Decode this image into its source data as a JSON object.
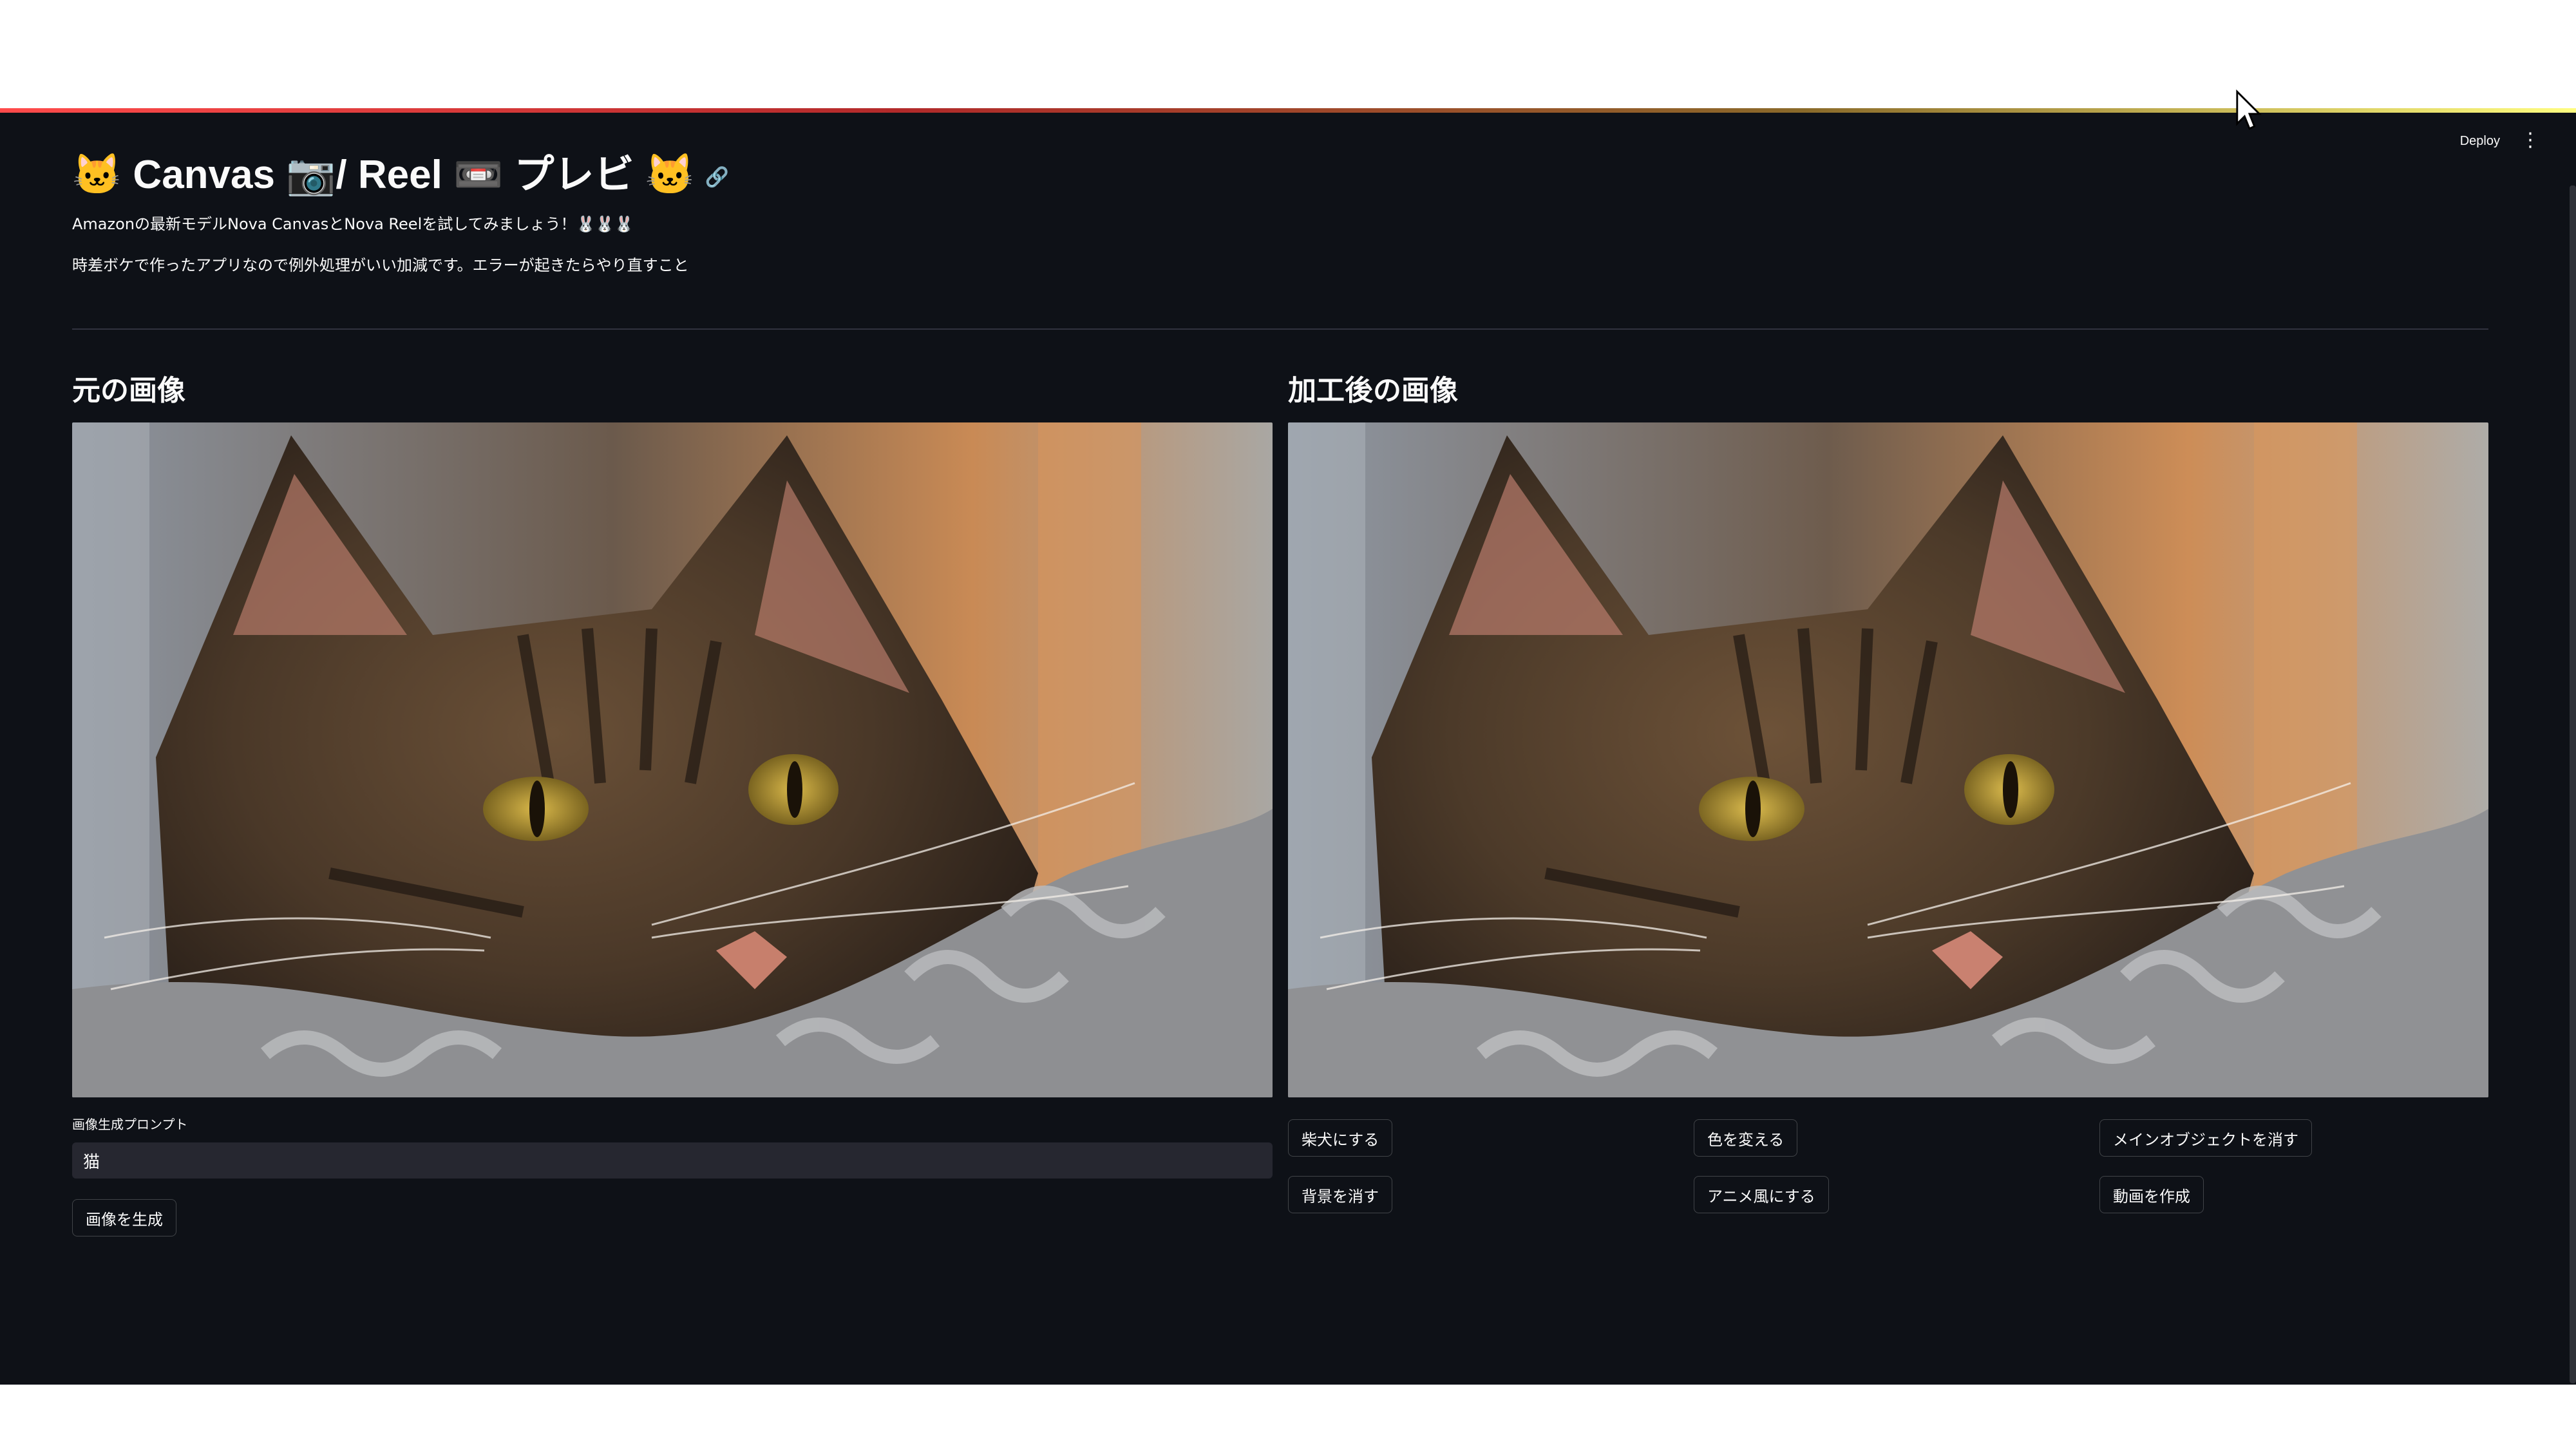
{
  "header": {
    "title": "🐱 Canvas 📷/ Reel 📼 プレビ 🐱",
    "link_icon": "link-icon",
    "deploy_label": "Deploy",
    "menu_icon": "vertical-dots-icon"
  },
  "captions": {
    "line1": "Amazonの最新モデルNova CanvasとNova Reelを試してみましょう！🐰🐰🐰",
    "line2": "時差ボケで作ったアプリなので例外処理がいい加減です。エラーが起きたらやり直すこと"
  },
  "left_column": {
    "heading": "元の画像",
    "image_alt": "tabby cat resting on knitted blanket",
    "prompt_label": "画像生成プロンプト",
    "prompt_value": "猫",
    "generate_button": "画像を生成"
  },
  "right_column": {
    "heading": "加工後の画像",
    "image_alt": "tabby cat resting on knitted blanket (processed)",
    "buttons": [
      "柴犬にする",
      "色を変える",
      "メインオブジェクトを消す",
      "背景を消す",
      "アニメ風にする",
      "動画を作成"
    ]
  },
  "colors": {
    "background": "#0e1117",
    "text": "#fafafa",
    "input_bg": "#262730",
    "accent_line_start": "#ff4b4b",
    "accent_line_end": "#fffd80"
  }
}
